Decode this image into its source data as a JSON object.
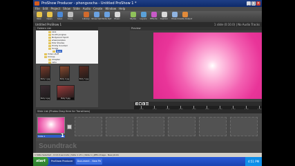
{
  "window": {
    "title": "ProShow Producer - phongvocha - Untitled ProShow 1 *",
    "minimize": "_",
    "maximize": "□",
    "close": "×"
  },
  "menu": [
    "File",
    "Edit",
    "Project",
    "Show",
    "Slide",
    "Audio",
    "Create",
    "Window",
    "Help"
  ],
  "toolbar": [
    {
      "label": "New",
      "color": "#e6c34a"
    },
    {
      "label": "Open",
      "color": "#e6c34a"
    },
    {
      "label": "Save",
      "color": "#4a88d6"
    },
    {
      "label": "Copy",
      "color": "#bdbdbd"
    },
    {
      "label": "Library",
      "color": "#d16a2c"
    },
    {
      "label": "Show Opt",
      "color": "#6aa1e0"
    },
    {
      "label": "Slide Opt",
      "color": "#6aa1e0"
    },
    {
      "label": "Music",
      "color": "#d9d9d9"
    },
    {
      "label": "Styles",
      "color": "#8fc25a"
    },
    {
      "label": "Layers",
      "color": "#5aa0d8"
    },
    {
      "label": "Effects",
      "color": "#c85ac8"
    },
    {
      "label": "Caption",
      "color": "#d9d9d9"
    },
    {
      "label": "Music",
      "color": "#8fb3e0"
    },
    {
      "label": "Create Output",
      "color": "#e08a3a"
    }
  ],
  "project": {
    "name": "Untitled ProShow 1",
    "info": "1 slide (0:10.0) | No Audio Tracks"
  },
  "folders_header": "Folders List",
  "folders": [
    {
      "label": "ssss",
      "depth": 3,
      "selected": false
    },
    {
      "label": "South Junglee",
      "depth": 3,
      "selected": false
    },
    {
      "label": "Bollywood Spirit",
      "depth": 3,
      "selected": false
    },
    {
      "label": "www.peoples",
      "depth": 3,
      "selected": false
    },
    {
      "label": "Pink Shades",
      "depth": 3,
      "selected": false
    },
    {
      "label": "Priddy Scented",
      "depth": 3,
      "selected": false
    },
    {
      "label": "Songs",
      "depth": 3,
      "selected": false
    },
    {
      "label": "New",
      "depth": 4,
      "selected": true
    },
    {
      "label": "Video stuff",
      "depth": 2,
      "selected": false
    },
    {
      "label": "Crimes",
      "depth": 2,
      "selected": false
    },
    {
      "label": "Chapter",
      "depth": 3,
      "selected": false
    },
    {
      "label": "rahu",
      "depth": 3,
      "selected": false
    }
  ],
  "thumbnails": [
    {
      "caption": "Bolly 1.jpg",
      "color": "#7a3b2a"
    },
    {
      "caption": "Bolly 2.jpg",
      "color": "#8a4a2f"
    },
    {
      "caption": "Bolly 3.jpg",
      "color": "#5a2a20"
    },
    {
      "caption": "Bolly 4.jpg",
      "color": "#3a2a30"
    },
    {
      "caption": "Bolly 5.jpg",
      "color": "#9a3a3a"
    }
  ],
  "preview_header": "Preview",
  "transport": [
    "◀",
    "■",
    "▶",
    "▶▶"
  ],
  "timeline_labels": [
    "0:00",
    "0:10",
    "0:20",
    "0:30",
    "0:40",
    "0:50",
    "1:00",
    "1:10",
    "1:20",
    "1:30"
  ],
  "slidelist_header": "Slide List (Photos Drag Here for Transitions)",
  "slide": {
    "number": "1",
    "label": "Slide 1",
    "duration": "3.0"
  },
  "soundtrack_label": "Soundtrack",
  "status": "1 Slide Selected - 0:10.0 seconds  |  Slide 1 of 1  |  Slide 1  |  JPEG Image - New photo",
  "taskbar": {
    "start": "start",
    "tasks": [
      "ProShow Producer",
      "Document - New Pe"
    ],
    "clock": "4:51 PM"
  }
}
